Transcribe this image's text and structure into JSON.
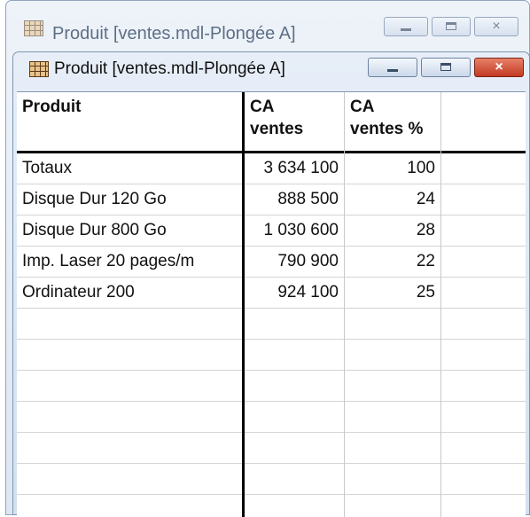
{
  "back_window": {
    "title": "Produit [ventes.mdl-Plongée A]",
    "icon": "table-app-icon"
  },
  "window": {
    "title": "Produit [ventes.mdl-Plongée A]",
    "icon": "table-app-icon",
    "controls": {
      "minimize": "minimize-icon",
      "maximize": "maximize-icon",
      "close": "×"
    }
  },
  "table": {
    "columns": [
      "Produit",
      "CA\nventes",
      "CA\nventes %",
      ""
    ],
    "rows": [
      [
        "Totaux",
        "3 634 100",
        "100"
      ],
      [
        "Disque Dur 120 Go",
        "888 500",
        "24"
      ],
      [
        "Disque Dur 800 Go",
        "1 030 600",
        "28"
      ],
      [
        "Imp. Laser 20 pages/m",
        "790 900",
        "22"
      ],
      [
        "Ordinateur 200",
        "924 100",
        "25"
      ]
    ],
    "empty_rows": 7
  },
  "colors": {
    "close_button": "#c23a22",
    "grid_line": "#c9c9c9"
  }
}
